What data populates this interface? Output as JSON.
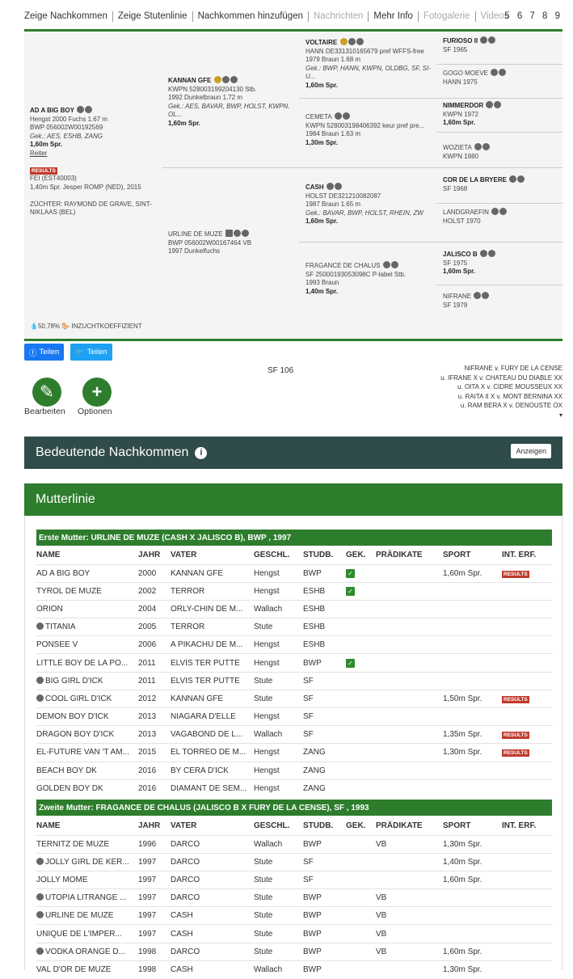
{
  "nav": {
    "items": [
      "Zeige Nachkommen",
      "Zeige Stutenlinie",
      "Nachkommen hinzufügen",
      "Nachrichten",
      "Mehr Info",
      "Fotogalerie",
      "Videos"
    ],
    "pages": "5 6 7 8 9"
  },
  "pedigree": {
    "main": {
      "name": "AD A BIG BOY",
      "l1": "Hengst 2000 Fuchs 1.67 m",
      "l2": "BWP 056002W00192569",
      "l3": "Gek.: AES, ESHB, ZANG",
      "l4": "1,60m Spr.",
      "link": "Reiter",
      "badge": "RESULTS",
      "fei1": "FEI (EST40003)",
      "fei2": "1,40m Spr. Jesper ROMP (NED), 2015",
      "breeder": "ZÜCHTER: RAYMOND DE GRAVE, SINT-NIKLAAS (BEL)",
      "pct": "50,78%",
      "coef": "INZUCHTKOEFFIZIENT"
    },
    "sire": {
      "name": "KANNAN GFE",
      "l1": "KWPN 528003199204130 Stb.",
      "l2": "1992 Dunkelbraun 1.72 m",
      "l3": "Gek.: AES, BAVAR, BWP, HOLST, KWPN, OL...",
      "l4": "1,60m Spr."
    },
    "dam": {
      "name": "URLINE DE MUZE",
      "l1": "BWP 056002W00167464 VB",
      "l2": "1997 Dunkelfuchs"
    },
    "ss": {
      "name": "VOLTAIRE",
      "l1": "HANN DE331310165679 pref WFFS-free",
      "l2": "1979 Braun 1.68 m",
      "l3": "Gek.: BWP, HANN, KWPN, OLDBG, SF, SI-U...",
      "l4": "1,60m Spr."
    },
    "sd": {
      "name": "CEMETA",
      "l1": "KWPN 528003198406392 keur pref pre...",
      "l2": "1984 Braun 1.63 m",
      "l4": "1,30m Spr."
    },
    "ds": {
      "name": "CASH",
      "l1": "HOLST DE321210082087",
      "l2": "1987 Braun 1.65 m",
      "l3": "Gek.: BAVAR, BWP, HOLST, RHEIN, ZW",
      "l4": "1,60m Spr."
    },
    "dd": {
      "name": "FRAGANCE DE CHALUS",
      "l1": "SF 25000193053098C P-label Stb.",
      "l2": "1993 Braun",
      "l4": "1,40m Spr."
    },
    "g4": [
      {
        "name": "FURIOSO II",
        "l1": "SF  1965"
      },
      {
        "name": "GOGO MOEVE",
        "l1": "HANN  1975"
      },
      {
        "name": "NIMMERDOR",
        "l1": "KWPN  1972",
        "l2": "1,60m Spr."
      },
      {
        "name": "WOZIETA",
        "l1": "KWPN  1980"
      },
      {
        "name": "COR DE LA BRYERE",
        "l1": "SF  1968"
      },
      {
        "name": "LANDGRAEFIN",
        "l1": "HOLST  1970"
      },
      {
        "name": "JALISCO B",
        "l1": "SF  1975",
        "l2": "1,60m Spr."
      },
      {
        "name": "NIFRANE",
        "l1": "SF  1979"
      }
    ]
  },
  "share": {
    "fb": "Teilen",
    "tw": "Teilen"
  },
  "actions": {
    "edit": "Bearbeiten",
    "options": "Optionen"
  },
  "sfnum": "SF 106",
  "ancestry": [
    "NIFRANE v. FURY DE LA CENSE",
    "u. IFRANE X v. CHATEAU DU DIABLE XX",
    "u. OITA X v. CIDRE MOUSSEUX XX",
    "u. RAITA II X v. MONT BERNINA XX",
    "u. RAM BERA X v. DENOUSTE OX"
  ],
  "panel1": {
    "title": "Bedeutende Nachkommen",
    "button": "Anzeigen"
  },
  "panel2": {
    "title": "Mutterlinie"
  },
  "cols": [
    "NAME",
    "JAHR",
    "VATER",
    "GESCHL.",
    "STUDB.",
    "GEK.",
    "PRÄDIKATE",
    "SPORT",
    "INT. ERF."
  ],
  "first": {
    "title": "Erste Mutter: URLINE DE MUZE (CASH X JALISCO B), BWP , 1997",
    "rows": [
      [
        "AD A BIG BOY",
        "2000",
        "KANNAN GFE",
        "Hengst",
        "BWP",
        "x",
        "",
        "1,60m Spr.",
        "RESULTS",
        ""
      ],
      [
        "TYROL DE MUZE",
        "2002",
        "TERROR",
        "Hengst",
        "ESHB",
        "x",
        "",
        "",
        "",
        ""
      ],
      [
        "ORION",
        "2004",
        "ORLY-CHIN DE M...",
        "Wallach",
        "ESHB",
        "",
        "",
        "",
        "",
        ""
      ],
      [
        "TITANIA",
        "2005",
        "TERROR",
        "Stute",
        "ESHB",
        "",
        "",
        "",
        "",
        "i"
      ],
      [
        "PONSEE V",
        "2006",
        "A PIKACHU DE M...",
        "Hengst",
        "ESHB",
        "",
        "",
        "",
        "",
        ""
      ],
      [
        "LITTLE BOY DE LA PO...",
        "2011",
        "ELVIS TER PUTTE",
        "Hengst",
        "BWP",
        "x",
        "",
        "",
        "",
        ""
      ],
      [
        "BIG GIRL D'ICK",
        "2011",
        "ELVIS TER PUTTE",
        "Stute",
        "SF",
        "",
        "",
        "",
        "",
        "i"
      ],
      [
        "COOL GIRL D'ICK",
        "2012",
        "KANNAN GFE",
        "Stute",
        "SF",
        "",
        "",
        "1,50m Spr.",
        "RESULTS",
        "i"
      ],
      [
        "DEMON BOY D'ICK",
        "2013",
        "NIAGARA D'ELLE",
        "Hengst",
        "SF",
        "",
        "",
        "",
        "",
        ""
      ],
      [
        "DRAGON BOY D'ICK",
        "2013",
        "VAGABOND DE L...",
        "Wallach",
        "SF",
        "",
        "",
        "1,35m Spr.",
        "RESULTS",
        ""
      ],
      [
        "EL-FUTURE VAN 'T AM...",
        "2015",
        "EL TORREO DE M...",
        "Hengst",
        "ZANG",
        "",
        "",
        "1,30m Spr.",
        "RESULTS",
        ""
      ],
      [
        "BEACH BOY DK",
        "2016",
        "BY CERA D'ICK",
        "Hengst",
        "ZANG",
        "",
        "",
        "",
        "",
        ""
      ],
      [
        "GOLDEN BOY DK",
        "2016",
        "DIAMANT DE SEM...",
        "Hengst",
        "ZANG",
        "",
        "",
        "",
        "",
        ""
      ]
    ]
  },
  "second": {
    "title": "Zweite Mutter: FRAGANCE DE CHALUS (JALISCO B X FURY DE LA CENSE), SF , 1993",
    "rows": [
      [
        "TERNITZ DE MUZE",
        "1996",
        "DARCO",
        "Wallach",
        "BWP",
        "",
        "VB",
        "1,30m Spr.",
        "",
        ""
      ],
      [
        "JOLLY GIRL DE KER...",
        "1997",
        "DARCO",
        "Stute",
        "SF",
        "",
        "",
        "1,40m Spr.",
        "",
        "i"
      ],
      [
        "JOLLY MOME",
        "1997",
        "DARCO",
        "Stute",
        "SF",
        "",
        "",
        "1,60m Spr.",
        "",
        ""
      ],
      [
        "UTOPIA LITRANGE ...",
        "1997",
        "DARCO",
        "Stute",
        "BWP",
        "",
        "VB",
        "",
        "",
        "i"
      ],
      [
        "URLINE DE MUZE",
        "1997",
        "CASH",
        "Stute",
        "BWP",
        "",
        "VB",
        "",
        "",
        "i"
      ],
      [
        "UNIQUE DE L'IMPER...",
        "1997",
        "CASH",
        "Stute",
        "BWP",
        "",
        "VB",
        "",
        "",
        ""
      ],
      [
        "VODKA ORANGE D...",
        "1998",
        "DARCO",
        "Stute",
        "BWP",
        "",
        "VB",
        "1,60m Spr.",
        "",
        "i"
      ],
      [
        "VAL D'OR DE MUZE",
        "1998",
        "CASH",
        "Wallach",
        "BWP",
        "",
        "",
        "1,30m Spr.",
        "",
        ""
      ]
    ]
  }
}
